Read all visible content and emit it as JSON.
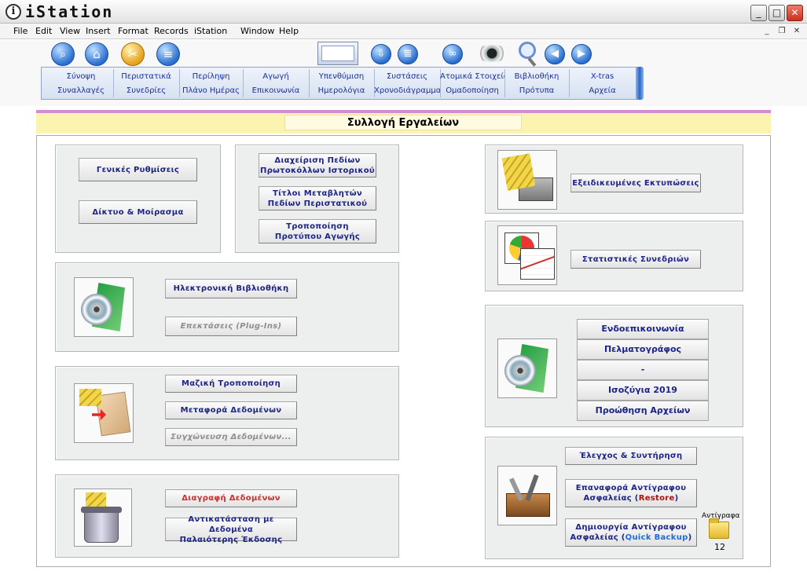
{
  "window": {
    "title": "iStation",
    "logo_letter": "i"
  },
  "menu": [
    "File",
    "Edit",
    "View",
    "Insert",
    "Format",
    "Records",
    "iStation",
    "Window",
    "Help"
  ],
  "nav": {
    "row1": [
      "Σύνοψη",
      "Περιστατικά",
      "Περίληψη",
      "Αγωγή",
      "Υπενθύμιση",
      "Συστάσεις",
      "Ατομικά Στοιχεία",
      "Βιβλιοθήκη",
      "X-tras"
    ],
    "row2": [
      "Συναλλαγές",
      "Συνεδρίες",
      "Πλάνο Ημέρας",
      "Επικοινωνία",
      "Ημερολόγια",
      "Χρονοδιάγραμμα",
      "Ομαδοποίηση",
      "Πρότυπα",
      "Αρχεία"
    ]
  },
  "header": {
    "title": "Συλλογή Εργαλείων"
  },
  "settings": {
    "general": "Γενικές Ρυθμίσεις",
    "network": "Δίκτυο & Μοίρασμα"
  },
  "fields": {
    "history_fields_1": "Διαχείριση Πεδίων",
    "history_fields_2": "Πρωτοκόλλων Ιστορικού",
    "case_titles_1": "Τίτλοι Μεταβλητών",
    "case_titles_2": "Πεδίων Περιστατικού",
    "treatment_template_1": "Τροποποίηση",
    "treatment_template_2": "Προτύπου Αγωγής"
  },
  "library": {
    "ebook": "Ηλεκτρονική Βιβλιοθήκη",
    "plugins": "Επεκτάσεις (Plug-Ins)"
  },
  "data_tools": {
    "bulk_edit": "Μαζική Τροποποίηση",
    "transfer": "Μεταφορά Δεδομένων",
    "merge": "Συγχώνευση Δεδομένων..."
  },
  "delete_tools": {
    "delete": "Διαγραφή Δεδομένων",
    "replace_1": "Αντικατάσταση με Δεδομένα",
    "replace_2": "Παλαιότερης Έκδοσης"
  },
  "printing": {
    "custom": "Εξειδικευμένες Εκτυπώσεις"
  },
  "stats": {
    "sessions": "Στατιστικές Συνεδριών"
  },
  "comms": [
    "Ενδοεπικοινωνία",
    "Πελματογράφος",
    "-",
    "Ισοζύγια 2019",
    "Προώθηση Αρχείων"
  ],
  "maintenance": {
    "check": "Έλεγχος & Συντήρηση",
    "restore_1": "Επαναφορά Αντίγραφου",
    "restore_2": "Ασφαλείας (",
    "restore_em": "Restore",
    "restore_3": ")",
    "backup_1": "Δημιουργία Αντίγραφου",
    "backup_2": "Ασφαλείας (",
    "backup_em": "Quick Backup",
    "backup_3": ")",
    "backups_label": "Αντίγραφα",
    "backups_count": "12"
  },
  "icons": {
    "toolbar": [
      "search-icon",
      "home-icon",
      "tools-icon",
      "list-icon",
      "window-preview-icon",
      "download-icon",
      "download-list-icon",
      "link-icon",
      "eye-icon",
      "magnifier-icon",
      "back-icon",
      "forward-icon"
    ],
    "accent": "#1c2488",
    "disabled": "#8e8e8e",
    "danger": "#d22b2b"
  }
}
